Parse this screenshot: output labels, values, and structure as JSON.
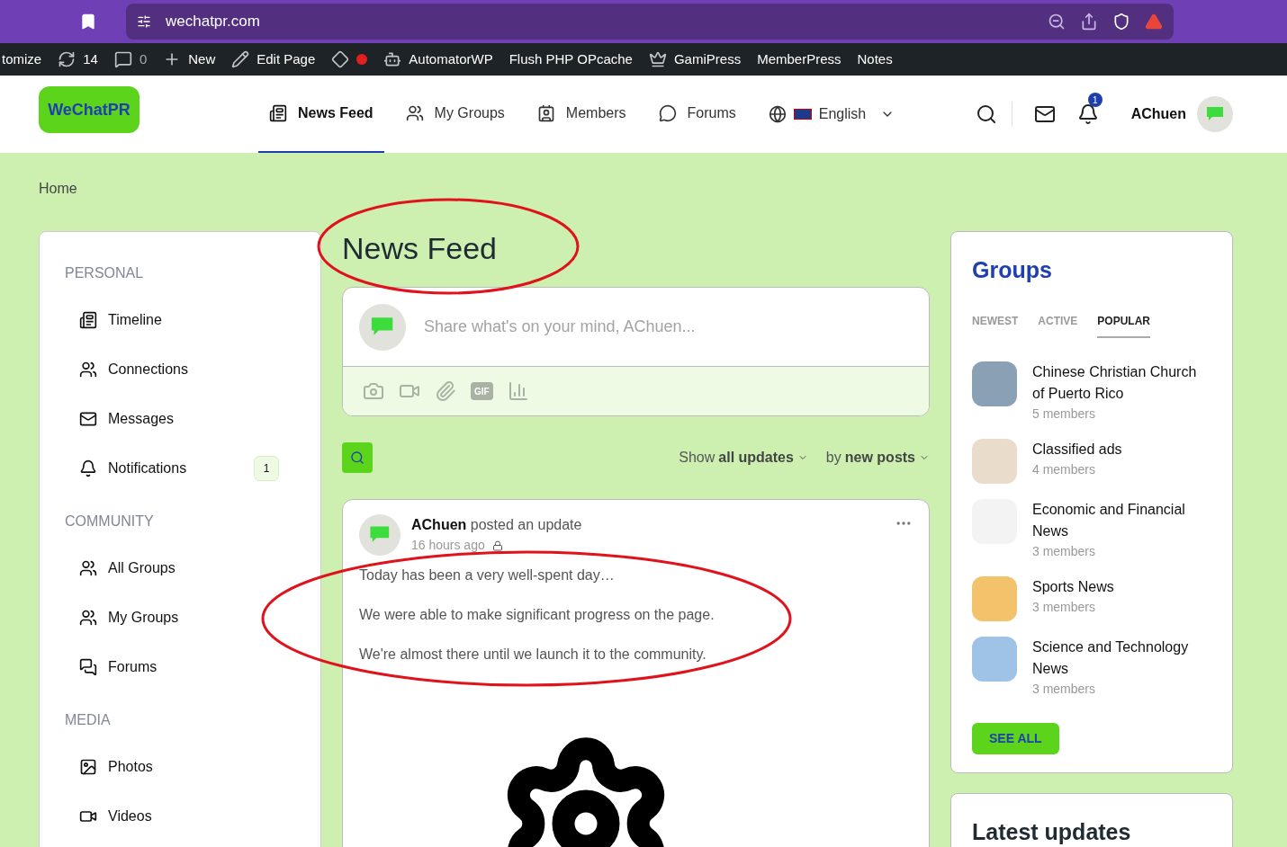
{
  "browser": {
    "url": "wechatpr.com"
  },
  "admin_bar": [
    {
      "label": "tomize"
    },
    {
      "label": "14"
    },
    {
      "label": "0"
    },
    {
      "label": "New"
    },
    {
      "label": "Edit Page"
    },
    {
      "kind": "dot"
    },
    {
      "label": "AutomatorWP"
    },
    {
      "label": "Flush PHP OPcache"
    },
    {
      "label": "GamiPress"
    },
    {
      "label": "MemberPress"
    },
    {
      "label": "Notes"
    }
  ],
  "header": {
    "logo": "WeChatPR",
    "nav": [
      {
        "label": "News Feed",
        "selected": true
      },
      {
        "label": "My Groups",
        "selected": false
      },
      {
        "label": "Members",
        "selected": false
      },
      {
        "label": "Forums",
        "selected": false
      }
    ],
    "language": "English",
    "notification_count": "1",
    "user": "AChuen"
  },
  "breadcrumb": "Home",
  "sidebar": [
    {
      "title": "PERSONAL",
      "items": [
        {
          "label": "Timeline"
        },
        {
          "label": "Connections"
        },
        {
          "label": "Messages"
        },
        {
          "label": "Notifications",
          "badge": "1"
        }
      ]
    },
    {
      "title": "COMMUNITY",
      "items": [
        {
          "label": "All Groups"
        },
        {
          "label": "My Groups"
        },
        {
          "label": "Forums"
        }
      ]
    },
    {
      "title": "MEDIA",
      "items": [
        {
          "label": "Photos"
        },
        {
          "label": "Videos"
        }
      ]
    }
  ],
  "feed": {
    "title": "News Feed",
    "composer_placeholder": "Share what's on your mind, AChuen...",
    "gif_label": "GIF",
    "filters": [
      {
        "prefix": "Show",
        "value": "all updates"
      },
      {
        "prefix": "by",
        "value": "new posts"
      }
    ],
    "post": {
      "author": "AChuen",
      "action": "posted an update",
      "time": "16 hours ago",
      "paragraphs": [
        "Today has been a very well-spent day…",
        "We were able to make significant progress on the page.",
        "We're almost there until we launch it to the community."
      ]
    }
  },
  "groups": {
    "title": "Groups",
    "tabs": [
      {
        "label": "NEWEST",
        "selected": false
      },
      {
        "label": "ACTIVE",
        "selected": false
      },
      {
        "label": "POPULAR",
        "selected": true
      }
    ],
    "items": [
      {
        "name": "Chinese Christian Church of Puerto Rico",
        "members": "5 members"
      },
      {
        "name": "Classified ads",
        "members": "4 members"
      },
      {
        "name": "Economic and Financial News",
        "members": "3 members"
      },
      {
        "name": "Sports News",
        "members": "3 members"
      },
      {
        "name": "Science and Technology News",
        "members": "3 members"
      }
    ],
    "button": "SEE ALL"
  },
  "latest": {
    "title": "Latest updates"
  }
}
